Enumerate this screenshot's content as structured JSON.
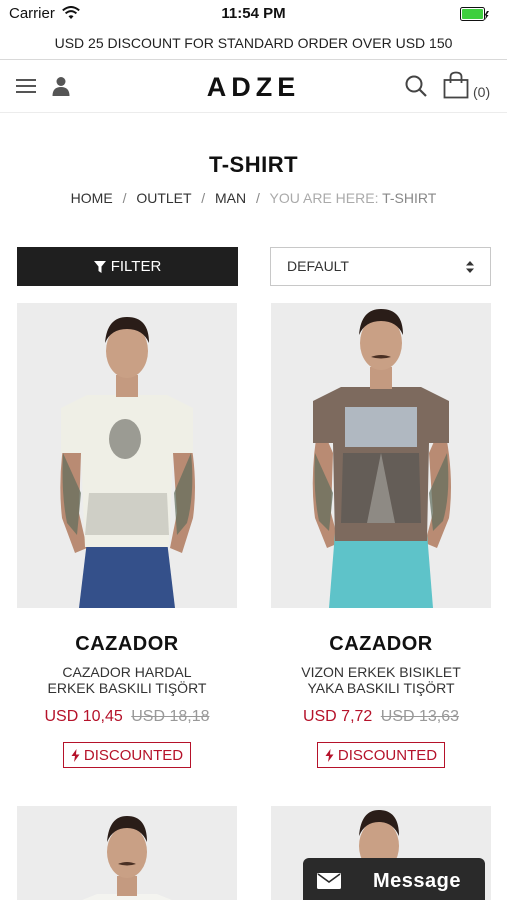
{
  "status_bar": {
    "carrier": "Carrier",
    "time": "11:54 PM"
  },
  "promo": {
    "text": "USD 25 DISCOUNT FOR STANDARD ORDER OVER USD 150"
  },
  "header": {
    "logo": "ADZE",
    "cart_count": "(0)"
  },
  "page": {
    "title": "T-SHIRT"
  },
  "breadcrumb": {
    "items": [
      "HOME",
      "OUTLET",
      "MAN"
    ],
    "current_prefix": "YOU ARE HERE: ",
    "current": "T-SHIRT"
  },
  "toolbar": {
    "filter_label": "FILTER",
    "sort_value": "DEFAULT"
  },
  "products": [
    {
      "brand": "CAZADOR",
      "name_line1": "CAZADOR HARDAL",
      "name_line2": "ERKEK BASKILI TIŞÖRT",
      "price": "USD 10,45",
      "old_price": "USD 18,18",
      "badge": "DISCOUNTED",
      "shirt_color": "#efefe6",
      "pants_color": "#34508a"
    },
    {
      "brand": "CAZADOR",
      "name_line1": "VIZON ERKEK BISIKLET",
      "name_line2": "YAKA BASKILI TIŞÖRT",
      "price": "USD 7,72",
      "old_price": "USD 13,63",
      "badge": "DISCOUNTED",
      "shirt_color": "#7d6a5e",
      "pants_color": "#5ec3c9"
    }
  ],
  "chat": {
    "label": "Message"
  },
  "colors": {
    "accent": "#b5122a",
    "dark": "#1f1f1f"
  }
}
